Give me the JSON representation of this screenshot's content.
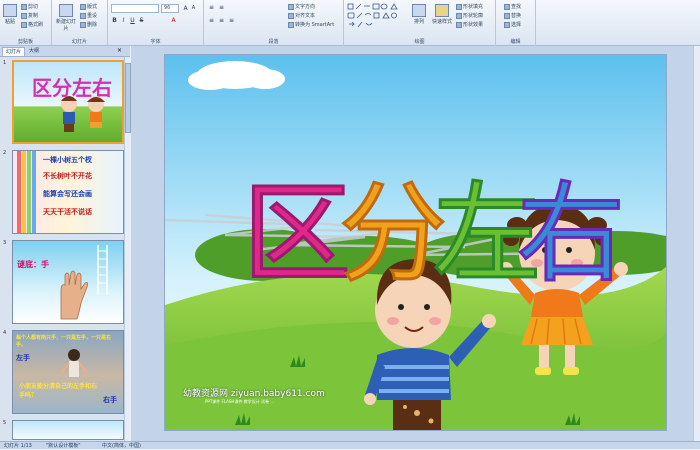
{
  "ribbon": {
    "clipboard": {
      "label": "剪贴板",
      "paste": "粘贴",
      "cut": "剪切",
      "copy": "复制",
      "format_painter": "格式刷"
    },
    "slides": {
      "label": "幻灯片",
      "new_slide": "新建幻灯片",
      "layout": "版式",
      "reset": "重设",
      "delete": "删除"
    },
    "font": {
      "label": "字体",
      "font_name": "",
      "font_size": "96"
    },
    "paragraph": {
      "label": "段落",
      "text_direction": "文字方向",
      "align_text": "对齐文本",
      "smartart": "转换为 SmartArt"
    },
    "drawing": {
      "label": "绘图",
      "arrange": "排列",
      "quick_styles": "快速样式",
      "shape_fill": "形状填充",
      "shape_outline": "形状轮廓",
      "shape_effects": "形状效果"
    },
    "editing": {
      "label": "编辑",
      "find": "查找",
      "replace": "替换",
      "select": "选择"
    }
  },
  "panel": {
    "tabs": [
      "幻灯片",
      "大纲"
    ],
    "thumbnails": [
      {
        "num": "1",
        "title": "区分左右"
      },
      {
        "num": "2",
        "lines": [
          "一棵小树五个杈",
          "不长树叶不开花",
          "能算会写还会画",
          "天天干活不说话"
        ]
      },
      {
        "num": "3",
        "lines": [
          "谜底：手"
        ]
      },
      {
        "num": "4",
        "lines": [
          "每个人都有两只手，一只是左手，一只是右手。",
          "左手",
          "小朋友能分清自己的左手和右手吗？",
          "右手"
        ]
      },
      {
        "num": "5",
        "lines": []
      }
    ]
  },
  "slide": {
    "title_chars": [
      "区",
      "分",
      "左",
      "右"
    ],
    "watermark": "幼教资源网 ziyuan.baby611.com",
    "watermark_sub": "PPT课件 FLASH课件 教学设计 试卷 ..."
  },
  "status": {
    "slide_pos": "幻灯片 1/13",
    "theme": "\"默认设计模板\"",
    "language": "中文(简体，中国)"
  },
  "colors": {
    "ribbon_bg": "#dbe5f2",
    "accent": "#f0a030"
  }
}
